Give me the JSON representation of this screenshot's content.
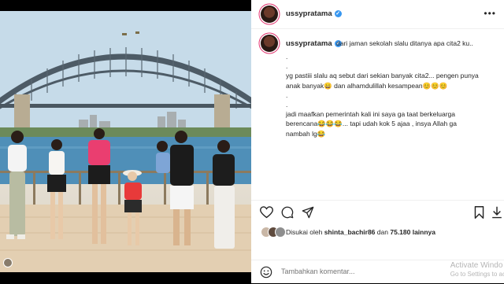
{
  "post": {
    "username": "ussypratama",
    "caption_first": "dari jaman sekolah slalu ditanya apa cita2 ku..",
    "caption_lines": [
      ".",
      ".",
      "yg pastiii slalu aq sebut dari sekian banyak cita2... pengen punya",
      "anak banyak😄 dan alhamdulillah kesampean😊😊😊",
      ".",
      ".",
      "jadi maafkan pemerintah kali ini saya ga taat berkeluarga",
      "berencana😂😂😂... tapi udah kok 5 ajaa , insya Allah ga",
      "nambah lg😂"
    ],
    "likes": {
      "prefix": "Disukai oleh",
      "liker": "shintа_bachir86",
      "middle": "dan",
      "count": "75.180 lainnya"
    },
    "comment_placeholder": "Tambahkan komentar..."
  },
  "icons": {
    "more": "more-icon",
    "heart": "heart-icon",
    "comment": "comment-icon",
    "share": "share-icon",
    "bookmark": "bookmark-icon",
    "emoji": "emoji-icon",
    "verified": "verified-badge-icon"
  },
  "watermark": {
    "line1": "Activate Windo",
    "line2": "Go to Settings to ac"
  },
  "colors": {
    "verified": "#3897f0",
    "story_ring": "#e1306c",
    "text": "#262626",
    "muted": "#8e8e8e"
  }
}
